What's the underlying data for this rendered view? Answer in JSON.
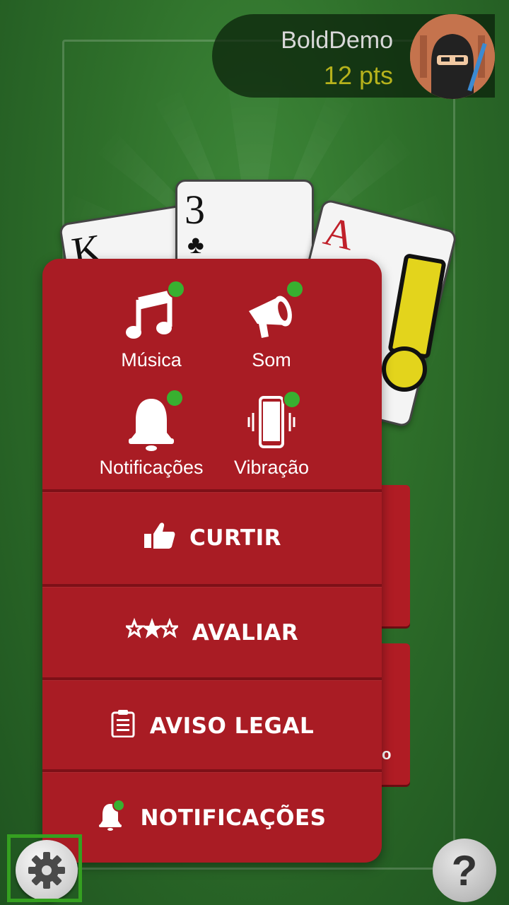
{
  "player": {
    "name": "BoldDemo",
    "points": "12 pts"
  },
  "cards": [
    {
      "rank": "K",
      "suit": ""
    },
    {
      "rank": "3",
      "suit": "♣"
    },
    {
      "rank": "A",
      "suit": ""
    }
  ],
  "settings": {
    "toggles": [
      {
        "label": "Música",
        "icon": "music-note-icon",
        "enabled": true
      },
      {
        "label": "Som",
        "icon": "megaphone-icon",
        "enabled": true
      },
      {
        "label": "Notificações",
        "icon": "bell-icon",
        "enabled": true
      },
      {
        "label": "Vibração",
        "icon": "vibration-phone-icon",
        "enabled": true
      }
    ],
    "menu": [
      {
        "label": "CURTIR",
        "icon": "thumbs-up-icon"
      },
      {
        "label": "AVALIAR",
        "icon": "stars-icon"
      },
      {
        "label": "AVISO LEGAL",
        "icon": "clipboard-icon"
      },
      {
        "label": "NOTIFICAÇÕES",
        "icon": "bell-icon"
      }
    ]
  },
  "side_buttons": [
    {
      "label": ""
    },
    {
      "label": "o"
    }
  ],
  "help_label": "?",
  "colors": {
    "panel": "#a91c24",
    "dot": "#38b030",
    "points": "#b6b21c",
    "felt": "#2e6f2a"
  }
}
